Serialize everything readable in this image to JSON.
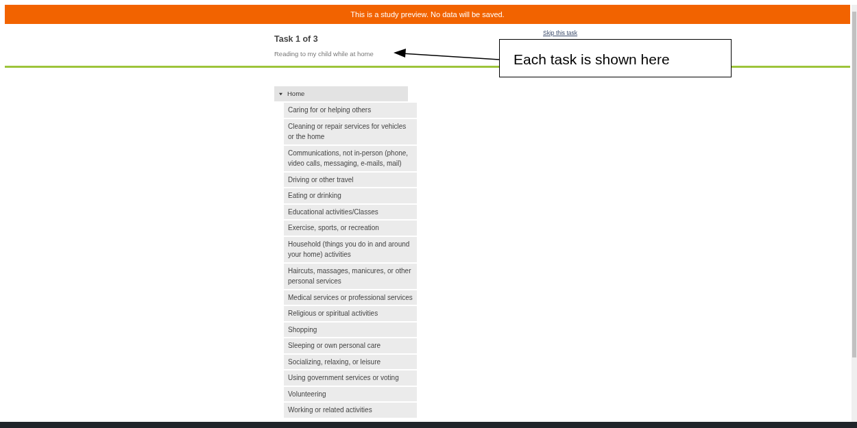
{
  "banner": {
    "text": "This is a study preview. No data will be saved."
  },
  "task": {
    "title": "Task 1 of 3",
    "description": "Reading to my child while at home",
    "skip_link": "Skip this task"
  },
  "annotation": {
    "text": "Each task is shown here"
  },
  "category": {
    "label": "Home",
    "expanded": true,
    "items": [
      "Caring for or helping others",
      "Cleaning or repair services for vehicles or the home",
      "Communications, not in-person (phone, video calls, messaging, e-mails, mail)",
      "Driving or other travel",
      "Eating or drinking",
      "Educational activities/Classes",
      "Exercise, sports, or recreation",
      "Household (things you do in and around your home) activities",
      "Haircuts, massages, manicures, or other personal services",
      "Medical services or professional services",
      "Religious or spiritual activities",
      "Shopping",
      "Sleeping or own personal care",
      "Socializing, relaxing, or leisure",
      "Using government services or voting",
      "Volunteering",
      "Working or related activities"
    ]
  }
}
